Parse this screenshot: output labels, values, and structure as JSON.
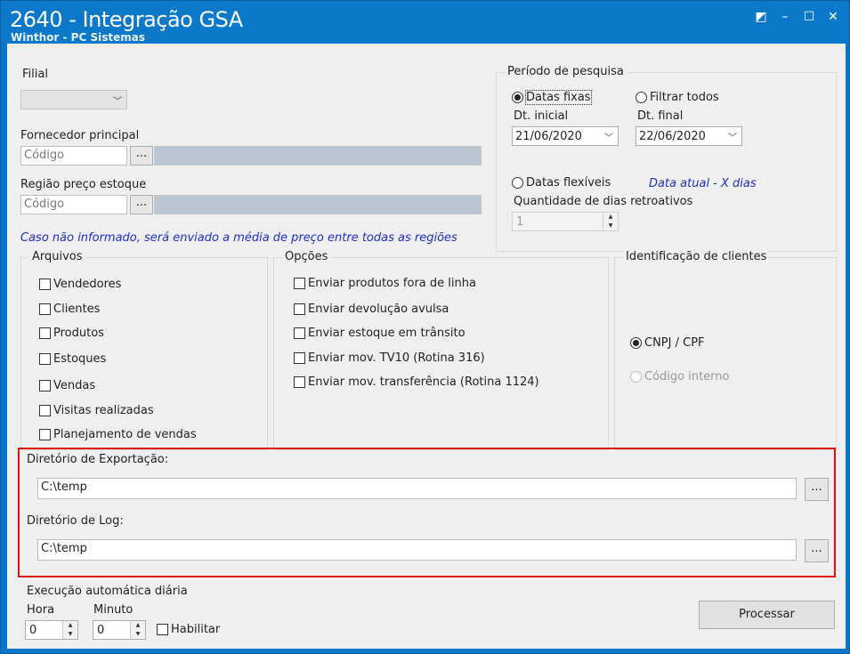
{
  "window": {
    "title": "2640 - Integração GSA",
    "subtitle": "Winthor - PC Sistemas",
    "controls": {
      "restore_icon": "◩",
      "minimize": "–",
      "maximize": "☐",
      "close": "✕"
    }
  },
  "filial": {
    "label": "Filial",
    "value": ""
  },
  "fornecedor": {
    "label": "Fornecedor principal",
    "placeholder": "Código",
    "button": "..."
  },
  "regiao": {
    "label": "Região preço estoque",
    "placeholder": "Código",
    "button": "..."
  },
  "info_note": "Caso não informado, será enviado a média de preço entre todas as regiões",
  "periodo": {
    "title": "Período de pesquisa",
    "datas_fixas": "Datas fixas",
    "filtrar_todos": "Filtrar todos",
    "dt_inicial_label": "Dt. inicial",
    "dt_inicial": "21/06/2020",
    "dt_final_label": "Dt. final",
    "dt_final": "22/06/2020",
    "datas_flexiveis": "Datas flexíveis",
    "data_atual_hint": "Data atual - X dias",
    "quantidade_label": "Quantidade de dias retroativos",
    "quantidade_value": "1"
  },
  "arquivos": {
    "title": "Arquivos",
    "items": [
      "Vendedores",
      "Clientes",
      "Produtos",
      "Estoques",
      "Vendas",
      "Visitas realizadas",
      "Planejamento de vendas"
    ]
  },
  "opcoes": {
    "title": "Opções",
    "items": [
      "Enviar produtos fora de linha",
      "Enviar devolução avulsa",
      "Enviar estoque em trânsito",
      "Enviar mov. TV10 (Rotina 316)",
      "Enviar mov. transferência (Rotina 1124)"
    ]
  },
  "identificacao": {
    "title": "Identificação de clientes",
    "cnpj": "CNPJ / CPF",
    "codigo_interno": "Código interno"
  },
  "diretorios": {
    "exportacao_label": "Diretório de Exportação:",
    "exportacao_value": "C:\\temp",
    "log_label": "Diretório de Log:",
    "log_value": "C:\\temp",
    "browse": "..."
  },
  "execucao": {
    "title": "Execução automática diária",
    "hora_label": "Hora",
    "hora_value": "0",
    "minuto_label": "Minuto",
    "minuto_value": "0",
    "habilitar": "Habilitar"
  },
  "processar_label": "Processar",
  "colors": {
    "title_bar": "#0b78c9",
    "highlight_border": "#e01010",
    "hint_text": "#1f2fc8"
  }
}
